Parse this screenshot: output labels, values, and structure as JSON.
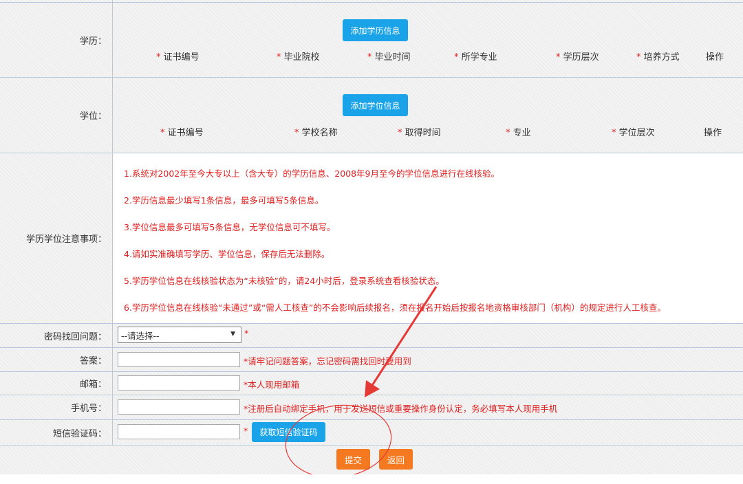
{
  "education": {
    "label": "学历：",
    "add_button": "添加学历信息",
    "columns": [
      "证书编号",
      "毕业院校",
      "毕业时间",
      "所学专业",
      "学历层次",
      "培养方式"
    ],
    "action": "操作"
  },
  "degree": {
    "label": "学位：",
    "add_button": "添加学位信息",
    "columns": [
      "证书编号",
      "学校名称",
      "取得时间",
      "专业",
      "学位层次"
    ],
    "action": "操作"
  },
  "notes": {
    "label": "学历学位注意事项：",
    "items": [
      "1.系统对2002年至今大专以上（含大专）的学历信息、2008年9月至今的学位信息进行在线核验。",
      "2.学历信息最少填写1条信息，最多可填写5条信息。",
      "3.学位信息最多可填写5条信息，无学位信息可不填写。",
      "4.请如实准确填写学历、学位信息，保存后无法删除。",
      "5.学历学位信息在线核验状态为“未核验”的，请24小时后，登录系统查看核验状态。",
      "6.学历学位信息在线核验“未通过”或“需人工核查”的不会影响后续报名，须在报名开始后按报名地资格审核部门（机构）的规定进行人工核查。"
    ]
  },
  "form": {
    "question": {
      "label": "密码找回问题：",
      "selected": "--请选择--",
      "hint": "*"
    },
    "answer": {
      "label": "答案：",
      "value": "",
      "hint": "*请牢记问题答案，忘记密码需找回时要用到"
    },
    "email": {
      "label": "邮箱：",
      "value": "",
      "hint": "*本人现用邮箱"
    },
    "phone": {
      "label": "手机号：",
      "value": "",
      "hint": "*注册后自动绑定手机，用于发送短信或重要操作身份认定，务必填写本人现用手机"
    },
    "sms": {
      "label": "短信验证码：",
      "value": "",
      "hint": "*",
      "button": "获取短信验证码"
    }
  },
  "actions": {
    "submit": "提交",
    "back": "返回"
  },
  "colors": {
    "accent_blue": "#1aa3e8",
    "accent_orange": "#f47920",
    "notice_red": "#e02020",
    "annotation_red": "#e53935"
  }
}
